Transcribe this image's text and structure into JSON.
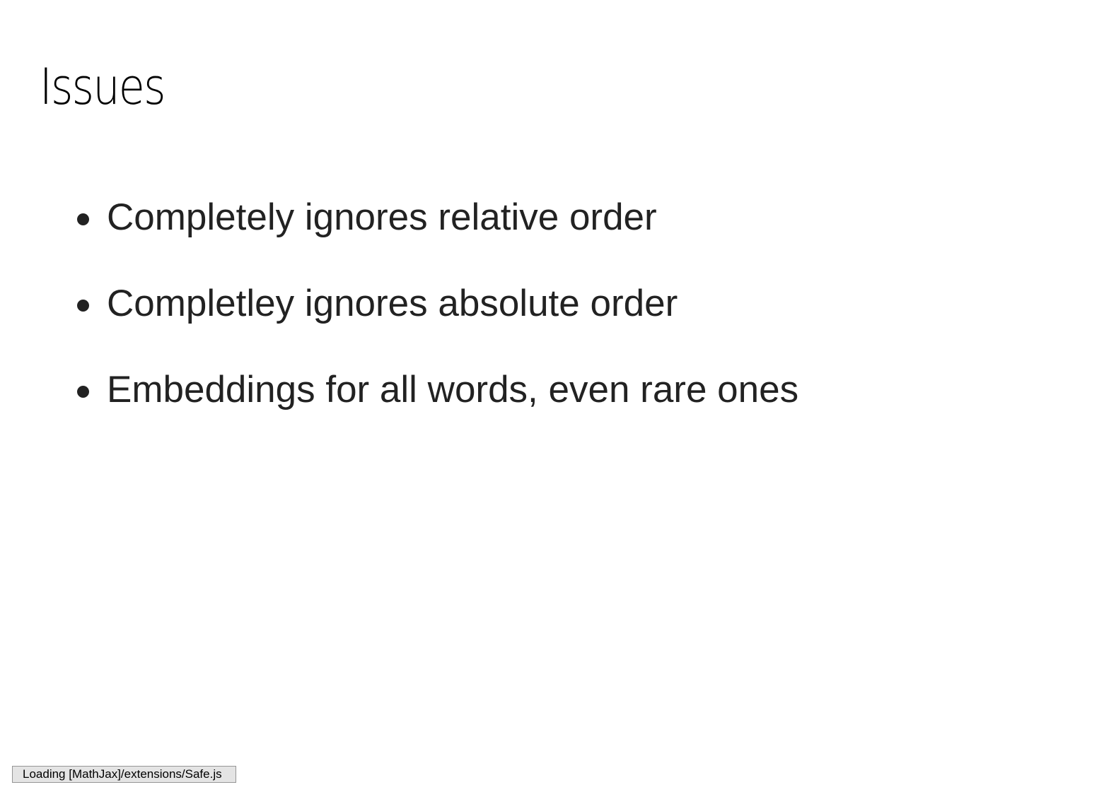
{
  "slide": {
    "title": "Issues",
    "bullets": [
      "Completely ignores relative order",
      "Completley ignores absolute order",
      "Embeddings for all words, even rare ones"
    ]
  },
  "status": {
    "text": "Loading [MathJax]/extensions/Safe.js"
  }
}
